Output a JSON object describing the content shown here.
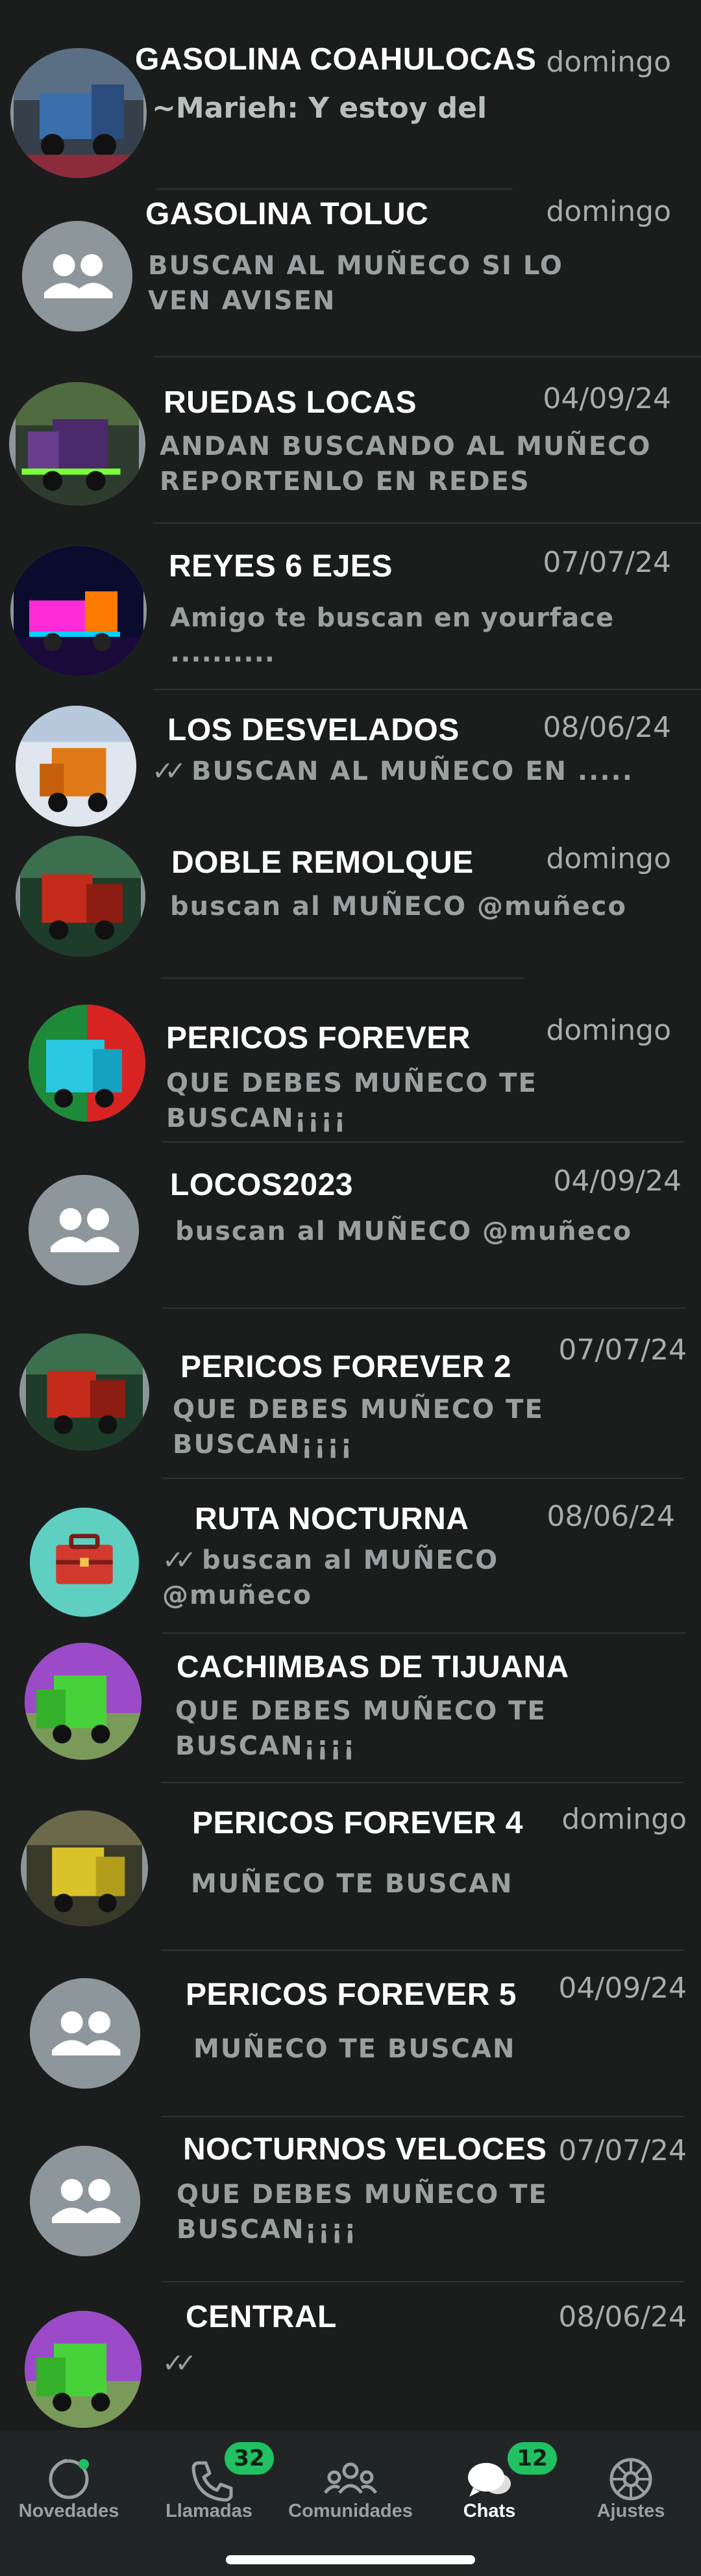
{
  "chats": [
    {
      "title": "GASOLINA COAHULOCAS",
      "date": "domingo",
      "preview": "~Marieh: Y estoy del",
      "ticks": false,
      "avatar": "truck-blue-icon"
    },
    {
      "title": "GASOLINA TOLUC",
      "date": "domingo",
      "preview": "BUSCAN AL MUÑECO SI LO VEN AVISEN",
      "ticks": false,
      "avatar": "group-icon"
    },
    {
      "title": "RUEDAS LOCAS",
      "date": "04/09/24",
      "preview": "ANDAN BUSCANDO AL MUÑECO REPORTENLO EN REDES",
      "ticks": false,
      "avatar": "truck-purple-icon"
    },
    {
      "title": "REYES 6 EJES",
      "date": "07/07/24",
      "preview": "Amigo te buscan en yourface ..........",
      "ticks": false,
      "avatar": "truck-neon-icon"
    },
    {
      "title": "LOS DESVELADOS",
      "date": "08/06/24",
      "preview": "BUSCAN AL MUÑECO EN .....",
      "ticks": true,
      "avatar": "truck-orange-icon"
    },
    {
      "title": "DOBLE REMOLQUE",
      "date": "domingo",
      "preview": "buscan al MUÑECO @muñeco",
      "ticks": false,
      "avatar": "truck-red-icon"
    },
    {
      "title": "PERICOS FOREVER",
      "date": "domingo",
      "preview": "QUE DEBES MUÑECO TE BUSCAN¡¡¡¡",
      "ticks": false,
      "avatar": "truck-cyan-icon"
    },
    {
      "title": "LOCOS2023",
      "date": "04/09/24",
      "preview": "buscan al MUÑECO @muñeco",
      "ticks": false,
      "avatar": "group-icon"
    },
    {
      "title": "PERICOS FOREVER 2",
      "date": "07/07/24",
      "preview": "QUE DEBES MUÑECO TE BUSCAN¡¡¡¡",
      "ticks": false,
      "avatar": "truck-red-icon"
    },
    {
      "title": "RUTA NOCTURNA",
      "date": "08/06/24",
      "preview": "buscan al MUÑECO @muñeco",
      "ticks": true,
      "avatar": "toolbox-icon"
    },
    {
      "title": "CACHIMBAS DE TIJUANA",
      "date": "",
      "preview": "QUE DEBES MUÑECO TE BUSCAN¡¡¡¡",
      "ticks": false,
      "avatar": "truck-green-icon"
    },
    {
      "title": "PERICOS FOREVER 4",
      "date": "domingo",
      "preview": "MUÑECO TE BUSCAN",
      "ticks": false,
      "avatar": "truck-yellow-icon"
    },
    {
      "title": "PERICOS FOREVER 5",
      "date": "04/09/24",
      "preview": "MUÑECO TE BUSCAN",
      "ticks": false,
      "avatar": "group-icon"
    },
    {
      "title": "NOCTURNOS VELOCES",
      "date": "07/07/24",
      "preview": "QUE DEBES MUÑECO TE BUSCAN¡¡¡¡",
      "ticks": false,
      "avatar": "group-icon"
    },
    {
      "title": "CENTRAL",
      "date": "08/06/24",
      "preview": "",
      "ticks": true,
      "avatar": "truck-green-icon"
    }
  ],
  "tabs": [
    {
      "label": "Novedades",
      "icon": "status-icon",
      "badge": ""
    },
    {
      "label": "Llamadas",
      "icon": "phone-icon",
      "badge": "32"
    },
    {
      "label": "Comunidades",
      "icon": "communities-icon",
      "badge": ""
    },
    {
      "label": "Chats",
      "icon": "chats-icon",
      "badge": "12"
    },
    {
      "label": "Ajustes",
      "icon": "settings-icon",
      "badge": ""
    }
  ],
  "colors": {
    "badge": "#21c063",
    "background": "#1b1d1d",
    "tabbar": "#222525"
  }
}
